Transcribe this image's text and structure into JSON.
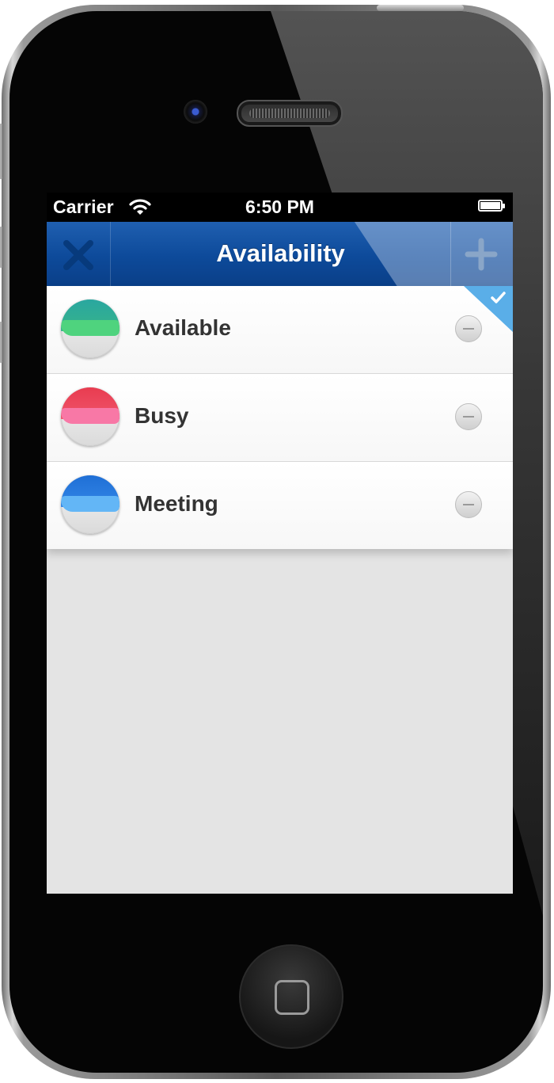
{
  "status_bar": {
    "carrier": "Carrier",
    "time": "6:50 PM"
  },
  "nav": {
    "title": "Availability",
    "close_icon": "close-icon",
    "add_icon": "plus-icon"
  },
  "items": [
    {
      "label": "Available",
      "color": "#3cc07a",
      "selected": true
    },
    {
      "label": "Busy",
      "color": "#f06a8a",
      "selected": false
    },
    {
      "label": "Meeting",
      "color": "#3b8fe3",
      "selected": false
    }
  ],
  "colors": {
    "nav": "#0d4a9a",
    "background": "#e4e4e4",
    "selected_corner": "#5aaee8"
  }
}
